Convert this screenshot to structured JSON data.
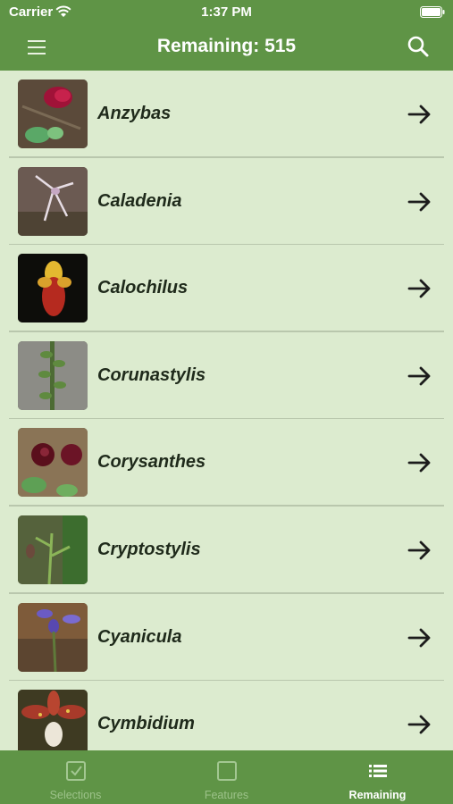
{
  "status_bar": {
    "carrier": "Carrier",
    "time": "1:37 PM"
  },
  "nav": {
    "title": "Remaining: 515",
    "menu_icon": "hamburger-menu-icon",
    "search_icon": "search-icon"
  },
  "genera": [
    {
      "name": "Anzybas"
    },
    {
      "name": "Caladenia"
    },
    {
      "name": "Calochilus"
    },
    {
      "name": "Corunastylis"
    },
    {
      "name": "Corysanthes"
    },
    {
      "name": "Cryptostylis"
    },
    {
      "name": "Cyanicula"
    },
    {
      "name": "Cymbidium"
    }
  ],
  "tabs": [
    {
      "label": "Selections",
      "icon": "checkbox-icon",
      "active": false
    },
    {
      "label": "Features",
      "icon": "square-icon",
      "active": false
    },
    {
      "label": "Remaining",
      "icon": "list-icon",
      "active": true
    }
  ],
  "colors": {
    "header": "#5f9446",
    "list_bg": "#dcebcf",
    "separator": "#b9c7ad"
  }
}
